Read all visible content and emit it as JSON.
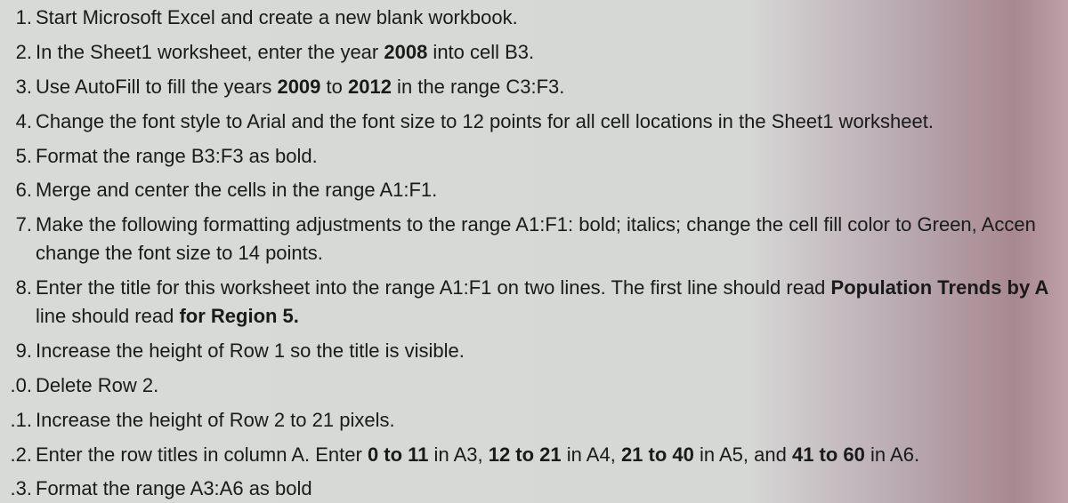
{
  "items": [
    {
      "num": "1.",
      "parts": [
        {
          "t": "Start Microsoft Excel and create a new blank workbook.",
          "b": false
        }
      ]
    },
    {
      "num": "2.",
      "parts": [
        {
          "t": "In the Sheet1 worksheet, enter the year ",
          "b": false
        },
        {
          "t": "2008",
          "b": true
        },
        {
          "t": " into cell B3.",
          "b": false
        }
      ]
    },
    {
      "num": "3.",
      "parts": [
        {
          "t": "Use AutoFill to fill the years ",
          "b": false
        },
        {
          "t": "2009",
          "b": true
        },
        {
          "t": " to ",
          "b": false
        },
        {
          "t": "2012",
          "b": true
        },
        {
          "t": " in the range C3:F3.",
          "b": false
        }
      ]
    },
    {
      "num": "4.",
      "parts": [
        {
          "t": "Change the font style to Arial and the font size to 12 points for all cell locations in the Sheet1 worksheet.",
          "b": false
        }
      ]
    },
    {
      "num": "5.",
      "parts": [
        {
          "t": "Format the range B3:F3 as bold.",
          "b": false
        }
      ]
    },
    {
      "num": "6.",
      "parts": [
        {
          "t": "Merge and center the cells in the range A1:F1.",
          "b": false
        }
      ]
    },
    {
      "num": "7.",
      "parts": [
        {
          "t": "Make the following formatting adjustments to the range A1:F1: bold; italics; change the cell fill color to  Green, Accen",
          "b": false
        }
      ],
      "cont": [
        {
          "t": "change the font size to 14 points.",
          "b": false
        }
      ]
    },
    {
      "num": "8.",
      "parts": [
        {
          "t": "Enter the title for this worksheet into the range A1:F1 on two lines. The first line should read ",
          "b": false
        },
        {
          "t": "Population Trends by A",
          "b": true
        }
      ],
      "cont": [
        {
          "t": "line should read ",
          "b": false
        },
        {
          "t": "for Region 5.",
          "b": true
        }
      ]
    },
    {
      "num": "9.",
      "parts": [
        {
          "t": "Increase the height of Row 1 so the title is visible.",
          "b": false
        }
      ]
    },
    {
      "num": ".0.",
      "parts": [
        {
          "t": "Delete Row 2.",
          "b": false
        }
      ]
    },
    {
      "num": ".1.",
      "parts": [
        {
          "t": "Increase the height of Row 2 to 21 pixels.",
          "b": false
        }
      ]
    },
    {
      "num": ".2.",
      "parts": [
        {
          "t": "Enter the row titles in column A. Enter ",
          "b": false
        },
        {
          "t": "0 to 11",
          "b": true
        },
        {
          "t": " in A3, ",
          "b": false
        },
        {
          "t": "12 to 21",
          "b": true
        },
        {
          "t": " in A4, ",
          "b": false
        },
        {
          "t": "21 to 40",
          "b": true
        },
        {
          "t": " in A5, and ",
          "b": false
        },
        {
          "t": "41 to 60",
          "b": true
        },
        {
          "t": " in A6.",
          "b": false
        }
      ]
    },
    {
      "num": ".3.",
      "parts": [
        {
          "t": "Format the range A3:A6 as bold",
          "b": false
        }
      ]
    }
  ]
}
